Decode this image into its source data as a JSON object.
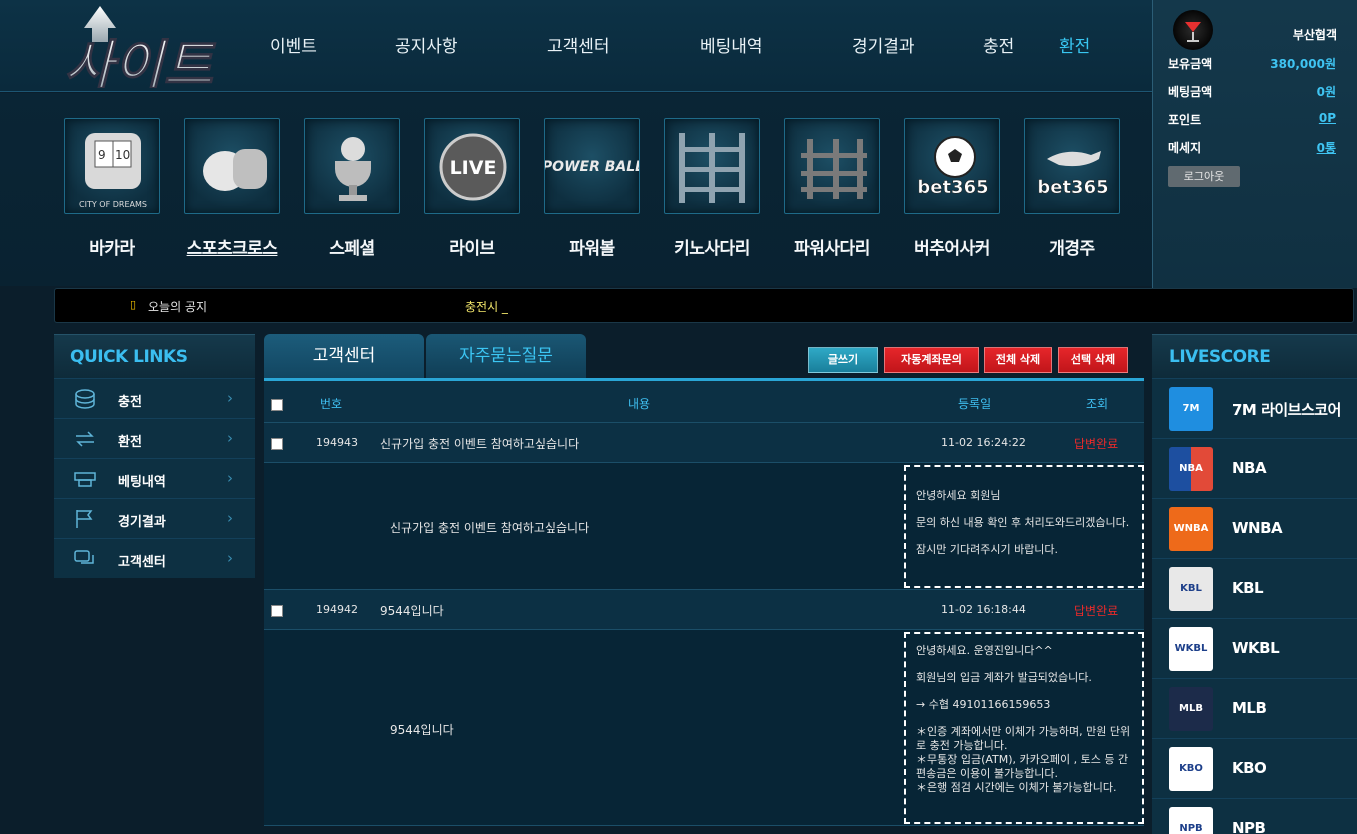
{
  "brand": {
    "logo_text": "사이트"
  },
  "nav": [
    "이벤트",
    "공지사항",
    "고객센터",
    "베팅내역",
    "경기결과",
    "충전",
    "환전"
  ],
  "games": [
    {
      "label": "바카라",
      "tile_text": "CITY OF DREAMS"
    },
    {
      "label": "스포츠크로스",
      "tile_text": ""
    },
    {
      "label": "스페셜",
      "tile_text": ""
    },
    {
      "label": "라이브",
      "tile_text": "LIVE"
    },
    {
      "label": "파워볼",
      "tile_text": "POWER BALL"
    },
    {
      "label": "키노사다리",
      "tile_text": ""
    },
    {
      "label": "파워사다리",
      "tile_text": ""
    },
    {
      "label": "버추어사커",
      "tile_text": "bet365"
    },
    {
      "label": "개경주",
      "tile_text": "bet365"
    }
  ],
  "user": {
    "name": "부산협객",
    "rows": [
      {
        "key": "보유금액",
        "value": "380,000원"
      },
      {
        "key": "베팅금액",
        "value": "0원"
      },
      {
        "key": "포인트",
        "value": "0P"
      },
      {
        "key": "메세지",
        "value": "0통"
      }
    ],
    "logout": "로그아웃"
  },
  "notice": {
    "icon": "▯",
    "label": "오늘의 공지",
    "text": "충전시 _"
  },
  "quick": {
    "title": "QUICK LINKS",
    "items": [
      "충전",
      "환전",
      "베팅내역",
      "경기결과",
      "고객센터"
    ]
  },
  "main": {
    "tabs": [
      "고객센터",
      "자주묻는질문"
    ],
    "buttons": [
      "글쓰기",
      "자동계좌문의",
      "전체 삭제",
      "선택 삭제"
    ],
    "headers": [
      "번호",
      "내용",
      "등록일",
      "조회"
    ],
    "posts": [
      {
        "num": "194943",
        "title": "신규가입 충전 이벤트 참여하고싶습니다",
        "date": "11-02 16:24:22",
        "status": "답변완료",
        "question": "신규가입 충전 이벤트 참여하고싶습니다",
        "answer": [
          "안녕하세요 회원님",
          "",
          "문의 하신 내용 확인 후 처리도와드리겠습니다.",
          "",
          "잠시만 기다려주시기 바랍니다."
        ]
      },
      {
        "num": "194942",
        "title": "9544입니다",
        "date": "11-02 16:18:44",
        "status": "답변완료",
        "question": "9544입니다",
        "answer": [
          "안녕하세요. 운영진입니다^^",
          "",
          "회원님의 입금 계좌가 발급되었습니다.",
          "",
          "→ 수협 49101166159653",
          "",
          " ＊인증 계좌에서만 이체가 가능하며, 만원 단위로 충전 가능합니다.",
          " ＊무통장 입금(ATM), 카카오페이 , 토스 등 간편송금은 이용이 불가능합니다.",
          " ＊은행 점검 시간에는 이체가 불가능합니다."
        ]
      }
    ]
  },
  "livescore": {
    "title": "LIVESCORE",
    "items": [
      {
        "label": "7M 라이브스코어",
        "logo": "7M",
        "color": "#1f8ee0"
      },
      {
        "label": "NBA",
        "logo": "NBA",
        "color": "#e24a38"
      },
      {
        "label": "WNBA",
        "logo": "WNBA",
        "color": "#ee6a1a"
      },
      {
        "label": "KBL",
        "logo": "KBL",
        "color": "#e8e8e8"
      },
      {
        "label": "WKBL",
        "logo": "WKBL",
        "color": "#ffffff"
      },
      {
        "label": "MLB",
        "logo": "MLB",
        "color": "#1c2b4a"
      },
      {
        "label": "KBO",
        "logo": "KBO",
        "color": "#ffffff"
      },
      {
        "label": "NPB",
        "logo": "NPB",
        "color": "#ffffff"
      }
    ]
  }
}
